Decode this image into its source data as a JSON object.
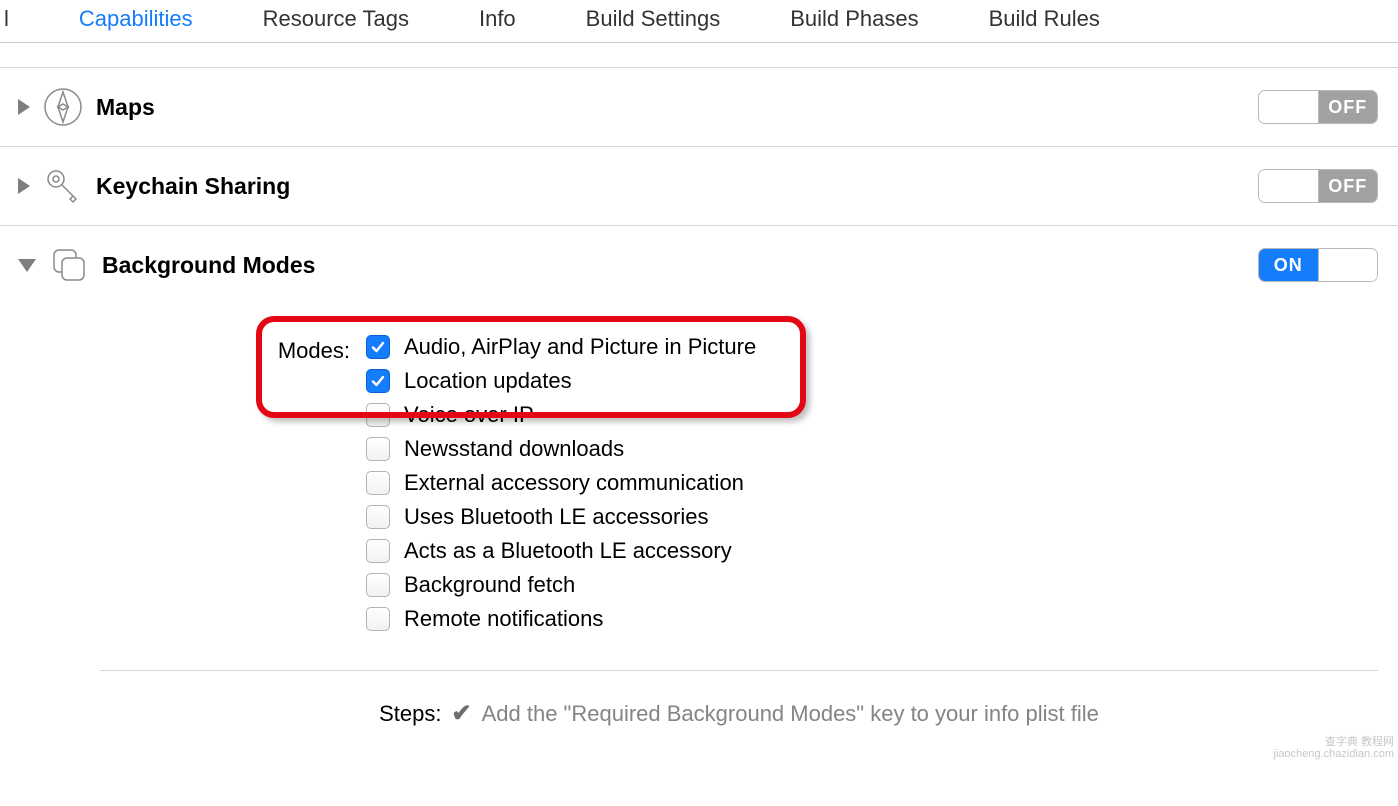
{
  "tabs": {
    "partial": "l",
    "capabilities": "Capabilities",
    "resource_tags": "Resource Tags",
    "info": "Info",
    "build_settings": "Build Settings",
    "build_phases": "Build Phases",
    "build_rules": "Build Rules"
  },
  "sections": {
    "maps": {
      "title": "Maps",
      "toggle": "OFF"
    },
    "keychain": {
      "title": "Keychain Sharing",
      "toggle": "OFF"
    },
    "background": {
      "title": "Background Modes",
      "toggle": "ON"
    }
  },
  "modes_label": "Modes:",
  "modes": [
    {
      "label": "Audio, AirPlay and Picture in Picture",
      "checked": true
    },
    {
      "label": "Location updates",
      "checked": true
    },
    {
      "label": "Voice over IP",
      "checked": false
    },
    {
      "label": "Newsstand downloads",
      "checked": false
    },
    {
      "label": "External accessory communication",
      "checked": false
    },
    {
      "label": "Uses Bluetooth LE accessories",
      "checked": false
    },
    {
      "label": "Acts as a Bluetooth LE accessory",
      "checked": false
    },
    {
      "label": "Background fetch",
      "checked": false
    },
    {
      "label": "Remote notifications",
      "checked": false
    }
  ],
  "steps": {
    "label": "Steps:",
    "text": "Add the \"Required Background Modes\" key to your info plist file"
  },
  "watermark": {
    "line1": "查字典 教程网",
    "line2": "jiaocheng.chazidian.com"
  }
}
